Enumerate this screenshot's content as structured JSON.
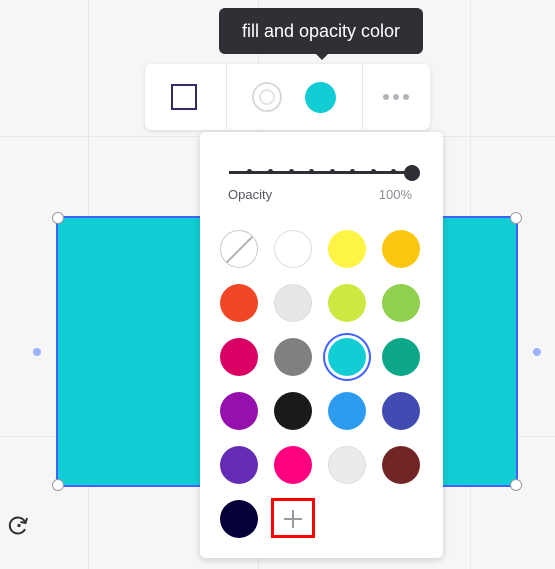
{
  "tooltip": {
    "text": "fill and opacity color"
  },
  "toolbar": {
    "shape_icon": "square-outline-icon",
    "border_icon": "border-color-icon",
    "fill_color": "#12cdd4",
    "more_icon": "more-dots-icon"
  },
  "popover": {
    "opacity_label": "Opacity",
    "opacity_value": "100%",
    "opacity": 100,
    "swatches": [
      [
        "transparent",
        "#ffffff",
        "#fef445",
        "#fac710"
      ],
      [
        "#f24726",
        "#e6e6e6",
        "#cee741",
        "#8fd14f"
      ],
      [
        "#da0063",
        "#808080",
        "#12cdd4",
        "#0ca789"
      ],
      [
        "#9510ac",
        "#1a1a1a",
        "#2d9bf0",
        "#414bb2"
      ],
      [
        "#652cb3",
        "#ff0080",
        "#ebebeb",
        "#722525"
      ],
      [
        "#050038"
      ]
    ],
    "selected_color": "#12cdd4",
    "add_icon": "plus-icon"
  },
  "canvas": {
    "shape_color": "#12cdd4",
    "selection_color": "#4262ff",
    "rotate_icon": "rotate-icon"
  }
}
